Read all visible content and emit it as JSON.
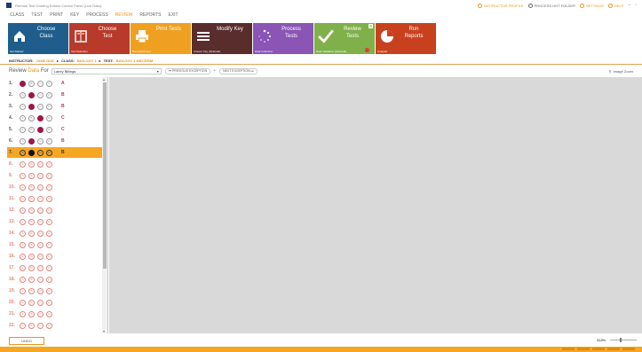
{
  "window": {
    "title": "Remark Test Grading Edition Control Panel (Live Data)",
    "right_items": [
      {
        "label": "INSTRUCTOR PROFILE",
        "accent": true
      },
      {
        "label": "PROCESS HOT FOLDER",
        "accent": false
      },
      {
        "label": "SETTINGS",
        "accent": true
      },
      {
        "label": "HELP",
        "accent": true
      }
    ]
  },
  "menu": {
    "items": [
      "CLASS",
      "TEST",
      "PRINT",
      "KEY",
      "PROCESS",
      "REVIEW",
      "REPORTS",
      "EXIT"
    ],
    "active": "REVIEW"
  },
  "ribbon": {
    "tiles": [
      {
        "label": "Choose Class",
        "sub": "Get Started",
        "color": "#1f5e8c",
        "icon": "house-icon"
      },
      {
        "label": "Choose Test",
        "sub": "Test Selection",
        "color": "#b83a2a",
        "icon": "book-icon"
      },
      {
        "label": "Print Tests",
        "sub": "Test Distribution",
        "color": "#f0a020",
        "icon": "printer-icon"
      },
      {
        "label": "Modify Key",
        "sub": "Answer Key (Optional)",
        "color": "#5a2d2d",
        "icon": "list-icon"
      },
      {
        "label": "Process Tests",
        "sub": "Data Collection",
        "color": "#8a55b5",
        "icon": "spinner-icon"
      },
      {
        "label": "Review Tests",
        "sub": "Data Validation (Optional)",
        "color": "#7fb04a",
        "icon": "checkmark-icon"
      },
      {
        "label": "Run Reports",
        "sub": "Analysis",
        "color": "#c8411e",
        "icon": "pie-chart-icon"
      }
    ]
  },
  "breadcrumb": {
    "instructor_label": "INSTRUCTOR:",
    "instructor": "JANE DOE",
    "class_label": "CLASS:",
    "class": "BIOLOGY 1",
    "test_label": "TEST:",
    "test": "BIOLOGY 1 MIDTERM"
  },
  "review": {
    "label_prefix": "Review",
    "label_dots": "Data",
    "label_for": "For",
    "student": "Laney Billings",
    "prev_exception": "PREVIOUS EXCEPTION",
    "next_exception": "NEXT EXCEPTION",
    "image_zoom": "Image Zoom"
  },
  "options": [
    "A",
    "B",
    "C",
    "D"
  ],
  "questions": [
    {
      "num": "1.",
      "answer": "A",
      "filled": 0
    },
    {
      "num": "2.",
      "answer": "B",
      "filled": 1
    },
    {
      "num": "3.",
      "answer": "B",
      "filled": 1
    },
    {
      "num": "4.",
      "answer": "C",
      "filled": 2
    },
    {
      "num": "5.",
      "answer": "C",
      "filled": 2
    },
    {
      "num": "6.",
      "answer": "B",
      "filled": 1
    },
    {
      "num": "7.",
      "answer": "B",
      "filled": 1,
      "selected": true
    },
    {
      "num": "8.",
      "answer": "",
      "filled": -1
    },
    {
      "num": "9.",
      "answer": "",
      "filled": -1
    },
    {
      "num": "10.",
      "answer": "",
      "filled": -1
    },
    {
      "num": "11.",
      "answer": "",
      "filled": -1
    },
    {
      "num": "12.",
      "answer": "",
      "filled": -1
    },
    {
      "num": "13.",
      "answer": "",
      "filled": -1
    },
    {
      "num": "14.",
      "answer": "",
      "filled": -1
    },
    {
      "num": "15.",
      "answer": "",
      "filled": -1
    },
    {
      "num": "16.",
      "answer": "",
      "filled": -1
    },
    {
      "num": "17.",
      "answer": "",
      "filled": -1
    },
    {
      "num": "18.",
      "answer": "",
      "filled": -1
    },
    {
      "num": "19.",
      "answer": "",
      "filled": -1
    },
    {
      "num": "20.",
      "answer": "",
      "filled": -1
    },
    {
      "num": "21.",
      "answer": "",
      "filled": -1
    },
    {
      "num": "22.",
      "answer": "",
      "filled": -1
    }
  ],
  "bottom": {
    "undo": "UNDO",
    "zoom": "313%"
  }
}
